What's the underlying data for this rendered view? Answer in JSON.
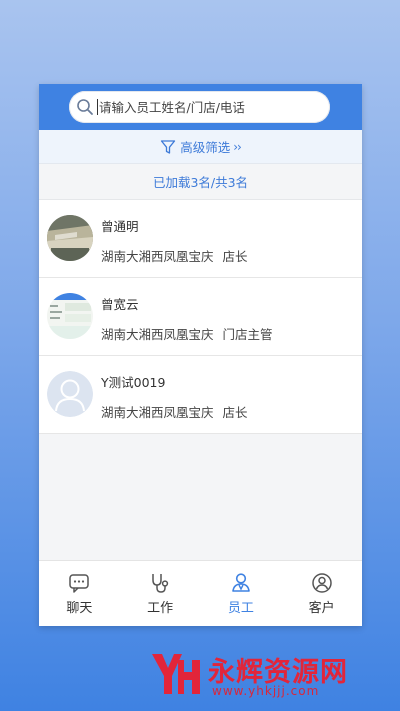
{
  "search": {
    "placeholder": "请输入员工姓名/门店/电话",
    "value": ""
  },
  "filter": {
    "label": "高级筛选",
    "chevron": "››"
  },
  "count_text": "已加载3名/共3名",
  "employees": [
    {
      "name": "曾通明",
      "store": "湖南大湘西凤凰宝庆",
      "role": "店长"
    },
    {
      "name": "曾宽云",
      "store": "湖南大湘西凤凰宝庆",
      "role": "门店主管"
    },
    {
      "name": "Y测试0019",
      "store": "湖南大湘西凤凰宝庆",
      "role": "店长"
    }
  ],
  "tabs": [
    {
      "label": "聊天",
      "icon": "chat-icon"
    },
    {
      "label": "工作",
      "icon": "stethoscope-icon"
    },
    {
      "label": "员工",
      "icon": "employee-icon",
      "active": true
    },
    {
      "label": "客户",
      "icon": "customer-icon"
    }
  ],
  "colors": {
    "accent": "#3f82e2",
    "accent_text": "#3d7ad8",
    "watermark": "#e2253a"
  },
  "watermark": {
    "text": "永辉资源网",
    "url": "www.yhkjjj.com",
    "logo": "YH"
  }
}
